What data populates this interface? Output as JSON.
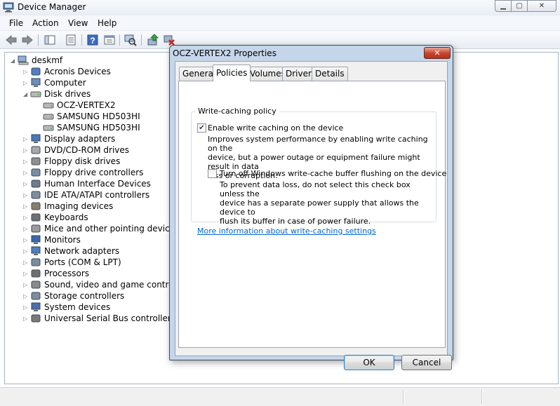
{
  "window": {
    "title": "Device Manager",
    "controls": {
      "minimize": "▁",
      "maximize": "▢",
      "close": "✕"
    }
  },
  "menu": {
    "items": [
      "File",
      "Action",
      "View",
      "Help"
    ]
  },
  "toolbar": {
    "icons": [
      "back-arrow-icon",
      "forward-arrow-icon",
      "show-hide-console-tree-icon",
      "properties-icon",
      "help-icon",
      "view-icon",
      "scan-hardware-icon",
      "update-driver-icon",
      "uninstall-icon"
    ]
  },
  "tree": {
    "root": "deskmf",
    "items": [
      {
        "label": "Acronis Devices",
        "icon": "acronis-devices-icon",
        "expander": "▷"
      },
      {
        "label": "Computer",
        "icon": "computer-icon",
        "expander": "▷"
      },
      {
        "label": "Disk drives",
        "icon": "disk-drives-icon",
        "expander": "◢"
      },
      {
        "label": "OCZ-VERTEX2",
        "icon": "disk-drive-icon",
        "expander": ""
      },
      {
        "label": "SAMSUNG HD503HI",
        "icon": "disk-drive-icon",
        "expander": ""
      },
      {
        "label": "SAMSUNG HD503HI",
        "icon": "disk-drive-icon",
        "expander": ""
      },
      {
        "label": "Display adapters",
        "icon": "display-adapters-icon",
        "expander": "▷"
      },
      {
        "label": "DVD/CD-ROM drives",
        "icon": "dvd-drive-icon",
        "expander": "▷"
      },
      {
        "label": "Floppy disk drives",
        "icon": "floppy-disk-icon",
        "expander": "▷"
      },
      {
        "label": "Floppy drive controllers",
        "icon": "floppy-controller-icon",
        "expander": "▷"
      },
      {
        "label": "Human Interface Devices",
        "icon": "hid-icon",
        "expander": "▷"
      },
      {
        "label": "IDE ATA/ATAPI controllers",
        "icon": "ide-controller-icon",
        "expander": "▷"
      },
      {
        "label": "Imaging devices",
        "icon": "imaging-devices-icon",
        "expander": "▷"
      },
      {
        "label": "Keyboards",
        "icon": "keyboard-icon",
        "expander": "▷"
      },
      {
        "label": "Mice and other pointing devices",
        "icon": "mouse-icon",
        "expander": "▷"
      },
      {
        "label": "Monitors",
        "icon": "monitor-icon",
        "expander": "▷"
      },
      {
        "label": "Network adapters",
        "icon": "network-adapter-icon",
        "expander": "▷"
      },
      {
        "label": "Ports (COM & LPT)",
        "icon": "ports-icon",
        "expander": "▷"
      },
      {
        "label": "Processors",
        "icon": "processor-icon",
        "expander": "▷"
      },
      {
        "label": "Sound, video and game controllers",
        "icon": "sound-icon",
        "expander": "▷"
      },
      {
        "label": "Storage controllers",
        "icon": "storage-controller-icon",
        "expander": "▷"
      },
      {
        "label": "System devices",
        "icon": "system-devices-icon",
        "expander": "▷"
      },
      {
        "label": "Universal Serial Bus controllers",
        "icon": "usb-icon",
        "expander": "▷"
      }
    ]
  },
  "dialog": {
    "title": "OCZ-VERTEX2 Properties",
    "close": "✕",
    "tabs": [
      "General",
      "Policies",
      "Volumes",
      "Driver",
      "Details"
    ],
    "active_tab": "Policies",
    "group_label": "Write-caching policy",
    "enable_caching": {
      "checked": true,
      "label": "Enable write caching on the device",
      "desc_lines": [
        "Improves system performance by enabling write caching on the",
        "device, but a power outage or equipment failure might result in data",
        "loss or corruption."
      ]
    },
    "turn_off_flushing": {
      "checked": false,
      "label": "Turn off Windows write-cache buffer flushing on the device",
      "desc_lines": [
        "To prevent data loss, do not select this check box unless the",
        "device has a separate power supply that allows the device to",
        "flush its buffer in case of power failure."
      ]
    },
    "more_info_link": "More information about write-caching settings",
    "ok_label": "OK",
    "cancel_label": "Cancel"
  }
}
